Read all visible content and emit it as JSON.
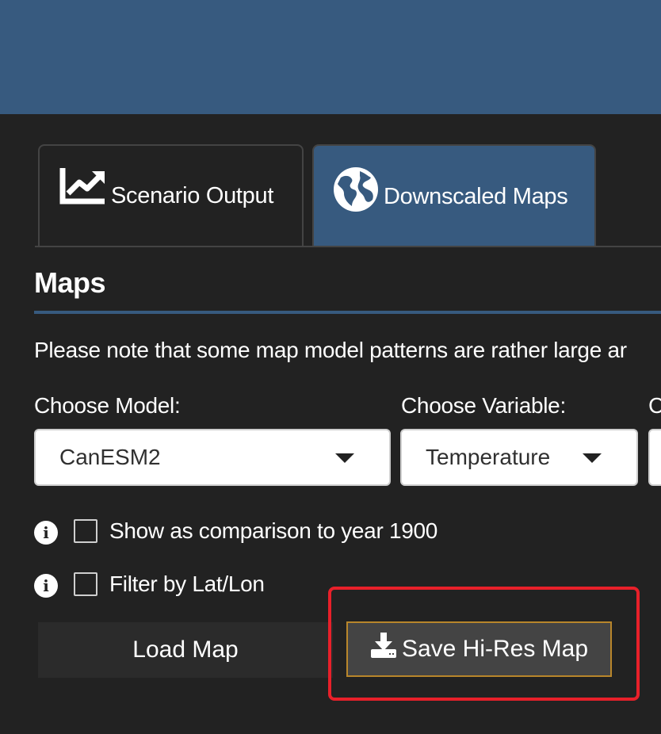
{
  "header": {
    "color": "#375a7f"
  },
  "tabs": [
    {
      "label": "Scenario Output",
      "icon": "chart-line-icon",
      "active": false
    },
    {
      "label": "Downscaled Maps",
      "icon": "globe-icon",
      "active": true
    }
  ],
  "section": {
    "title": "Maps",
    "note": "Please note that some map model patterns are rather large ar"
  },
  "selectors": {
    "model": {
      "label": "Choose Model:",
      "value": "CanESM2"
    },
    "variable": {
      "label": "Choose Variable:",
      "value": "Temperature"
    },
    "third": {
      "label": "C"
    }
  },
  "options": {
    "comparison": {
      "label": "Show as comparison to year 1900",
      "checked": false,
      "info_icon": "info-icon"
    },
    "filter": {
      "label": "Filter by Lat/Lon",
      "checked": false,
      "info_icon": "info-icon"
    }
  },
  "buttons": {
    "load": "Load Map",
    "save": "Save Hi-Res Map",
    "save_icon": "download-icon"
  },
  "colors": {
    "accent": "#375a7f",
    "highlight": "#e8202a",
    "save_border": "#b8862b"
  }
}
